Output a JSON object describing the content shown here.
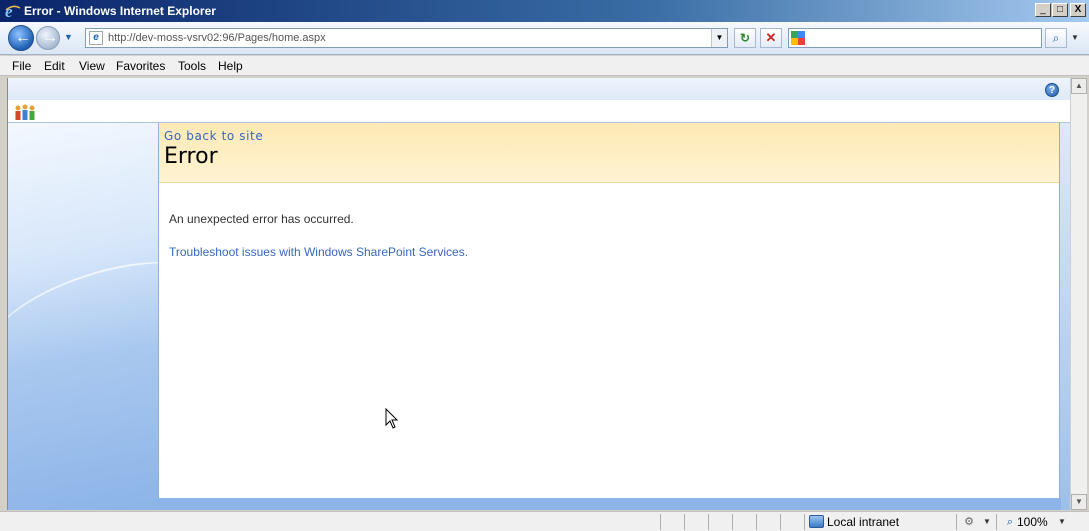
{
  "window": {
    "title": "Error - Windows Internet Explorer",
    "controls": {
      "minimize": "_",
      "maximize": "□",
      "close": "X"
    }
  },
  "address_bar": {
    "url": "http://dev-moss-vsrv02:96/Pages/home.aspx",
    "search_value": ""
  },
  "menu": {
    "items": [
      "File",
      "Edit",
      "View",
      "Favorites",
      "Tools",
      "Help"
    ]
  },
  "page": {
    "go_back_link": "Go back to site",
    "title": "Error",
    "message": "An unexpected error has occurred.",
    "troubleshoot_link": "Troubleshoot issues with Windows SharePoint Services."
  },
  "status": {
    "zone": "Local intranet",
    "zoom": "100%"
  },
  "icons": {
    "help": "?",
    "refresh": "↻",
    "stop": "✕",
    "search_go": "⌕"
  }
}
